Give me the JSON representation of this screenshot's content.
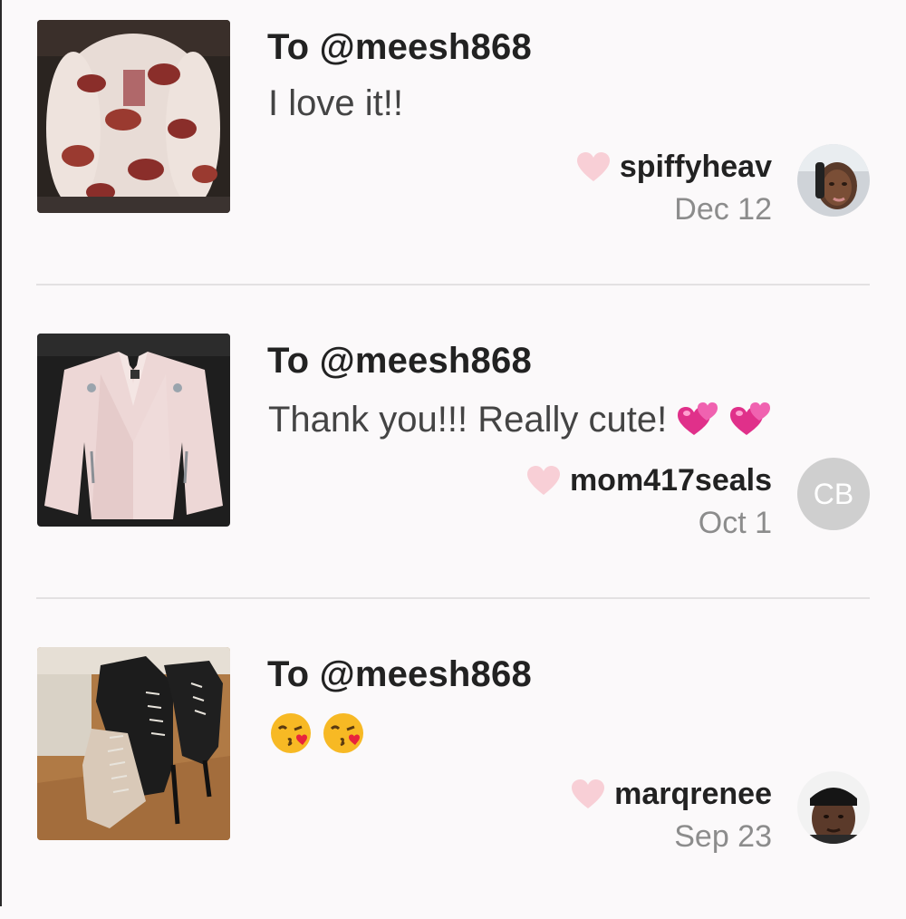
{
  "feed": {
    "items": [
      {
        "recipient": "To @meesh868",
        "message": "I love it!!",
        "username": "spiffyheav",
        "date": "Dec 12",
        "thumbnail": "faux-fur-jacket-photo",
        "avatar": "user-photo"
      },
      {
        "recipient": "To @meesh868",
        "message": "Thank you!!! Really cute!",
        "message_emoji": [
          "two-hearts-emoji",
          "two-hearts-emoji"
        ],
        "username": "mom417seals",
        "date": "Oct 1",
        "thumbnail": "pink-moto-jacket-photo",
        "avatar_initials": "CB"
      },
      {
        "recipient": "To @meesh868",
        "message": "",
        "message_emoji": [
          "face-blowing-kiss-emoji",
          "face-blowing-kiss-emoji"
        ],
        "username": "marqrenee",
        "date": "Sep 23",
        "thumbnail": "studded-heel-boots-photo",
        "avatar": "user-photo"
      }
    ]
  },
  "colors": {
    "background": "#fbf9fa",
    "heart": "#f8cfd6",
    "username": "#222222",
    "date": "#8c8c8c",
    "divider": "#e3e1e2",
    "avatar_placeholder": "#cfcfcf"
  }
}
